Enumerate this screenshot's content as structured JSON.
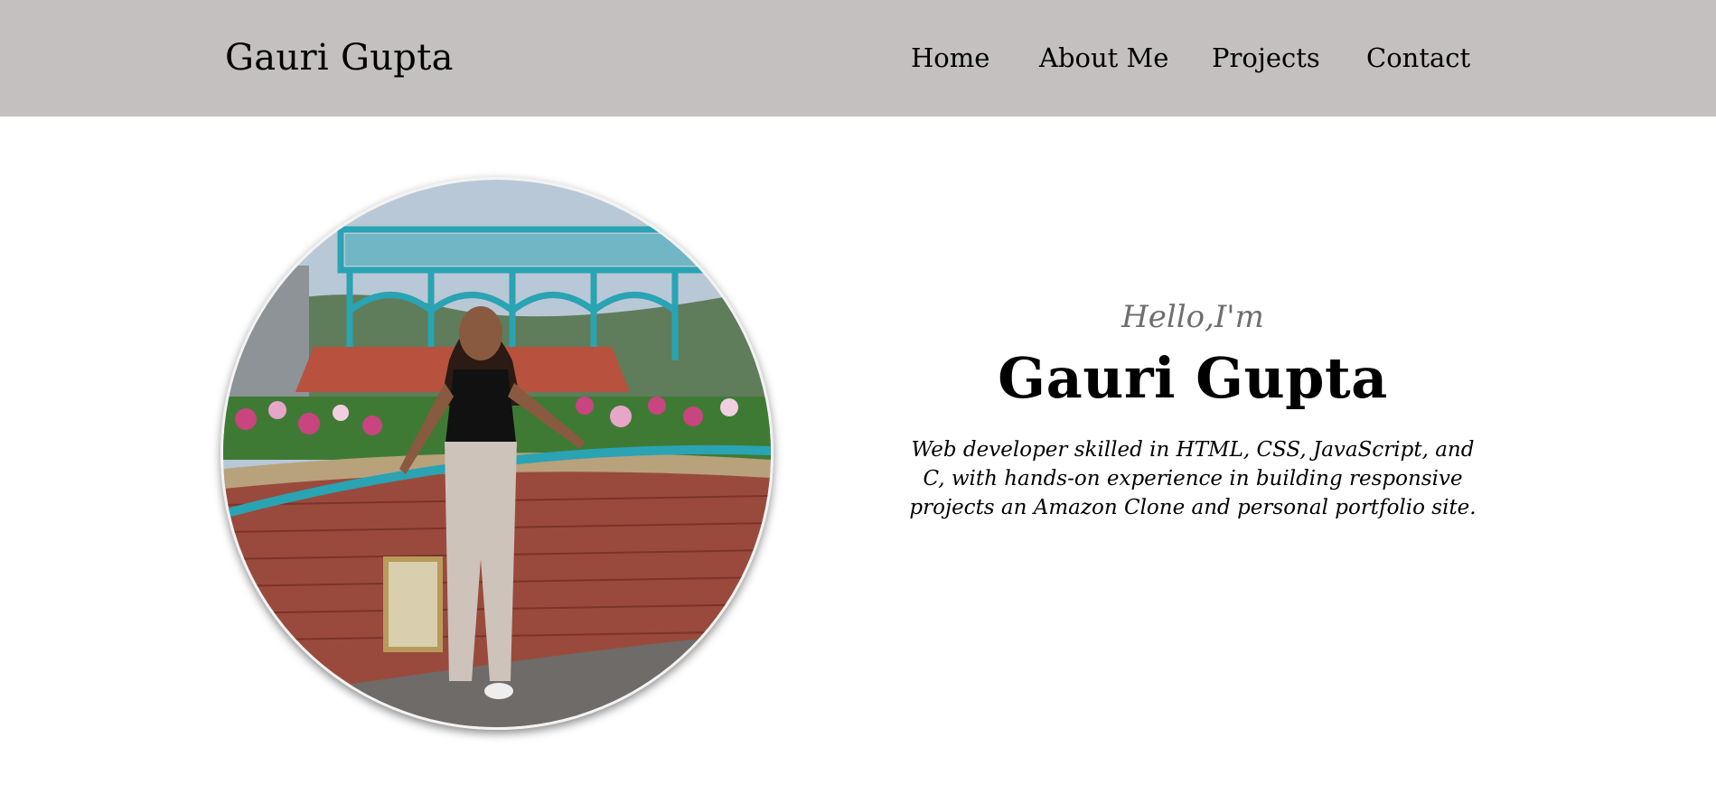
{
  "header": {
    "brand": "Gauri Gupta",
    "nav": [
      {
        "label": "Home"
      },
      {
        "label": "About Me"
      },
      {
        "label": "Projects"
      },
      {
        "label": "Contact"
      }
    ],
    "background_color": "#c3c0bf"
  },
  "hero": {
    "greeting": "Hello,I'm",
    "name": "Gauri Gupta",
    "bio": "Web developer skilled in HTML, CSS, JavaScript, and C, with hands-on experience in building responsive projects an Amazon Clone and personal portfolio site.",
    "greeting_color": "#6e6e6e"
  },
  "colors": {
    "teal_railing": "#2aa3b3",
    "brick": "#9a4a3c",
    "flowers": "#c8457f",
    "foliage": "#3f7a35"
  }
}
